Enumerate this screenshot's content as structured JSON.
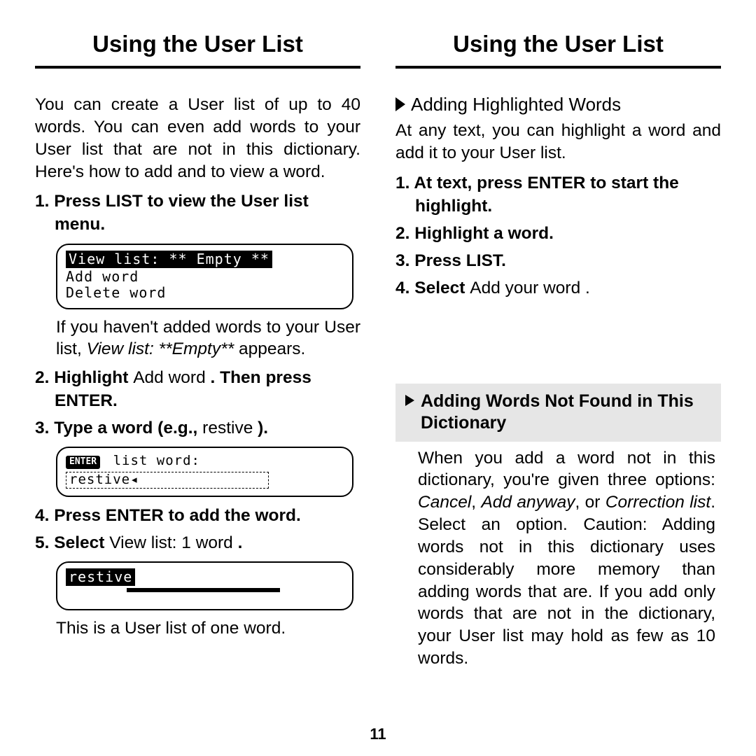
{
  "left": {
    "title": "Using the User List",
    "intro": "You can create a User list of up to 40 words. You can even add words to your User list that are not in this dictionary. Here's how to add and to view a word.",
    "step1_bold": "1. Press LIST to view the User list menu.",
    "lcd1_row1": "View list: ** Empty **",
    "lcd1_row2": "Add word",
    "lcd1_row3": "Delete word",
    "note1_a": "If you haven't added words to your User list, ",
    "note1_i": "View list: **Empty**",
    "note1_b": " appears.",
    "step2_pre": "2. Highlight ",
    "step2_plain": "Add word",
    "step2_post": " . Then press ENTER.",
    "step3_pre": "3. Type a word (e.g., ",
    "step3_plain": "restive ",
    "step3_post": ").",
    "lcd2_label": " list word:",
    "lcd2_enter": "ENTER",
    "lcd2_input": "restive◂",
    "step4": "4. Press ENTER to add the word.",
    "step5_pre": "5. Select ",
    "step5_plain": "View list: 1 word",
    "step5_post": " .",
    "lcd3_word": "restive",
    "note3": "This is a User list of one word."
  },
  "right": {
    "title": "Using the User List",
    "sub1": "Adding Highlighted Words",
    "sub1_body": "At any text, you can highlight a word and add it to your User list.",
    "r1": "1. At text, press ENTER to start the highlight.",
    "r2": "2. Highlight a word.",
    "r3": "3. Press LIST.",
    "r4_pre": "4. Select ",
    "r4_plain": "Add",
    "r4_post": " your word .",
    "boxhead": "Adding Words Not Found in This Dictionary",
    "box_a": "When you add a word not in this dictionary, you're given three options: ",
    "box_i1": "Cancel",
    "box_s1": ", ",
    "box_i2": "Add anyway",
    "box_s2": ", or ",
    "box_i3": "Correction list",
    "box_b": ". Select an option. ",
    "box_caution": "Caution:",
    "box_c": " Adding words not in this dictionary uses considerably more memory than adding words that are. If you add only words that are not in the dictionary, your User list may hold as few as 10 words."
  },
  "page_number": "11"
}
